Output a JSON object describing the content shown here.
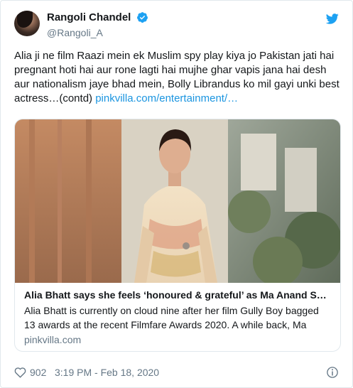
{
  "author": {
    "display_name": "Rangoli Chandel",
    "handle": "@Rangoli_A"
  },
  "tweet": {
    "text": "Alia ji ne film Raazi mein ek Muslim spy play kiya jo Pakistan jati hai pregnant hoti hai aur rone lagti hai mujhe ghar vapis jana hai desh aur nationalism jaye bhad mein, Bolly Librandus ko mil gayi unki best actress…(contd) ",
    "link_text": "pinkvilla.com/entertainment/…"
  },
  "card": {
    "title": "Alia Bhatt says she feels ‘honoured & grateful’ as Ma Anand S…",
    "description": "Alia Bhatt is currently on cloud nine after her film Gully Boy bagged 13 awards at the recent Filmfare Awards 2020. A while back, Ma",
    "domain": "pinkvilla.com"
  },
  "footer": {
    "likes": "902",
    "timestamp": "3:19 PM - Feb 18, 2020"
  },
  "icons": {
    "verified": "verified-badge-icon",
    "bird": "twitter-bird-icon",
    "heart": "heart-icon",
    "info": "info-icon"
  },
  "colors": {
    "accent": "#1da1f2",
    "link": "#1b95e0",
    "secondary_text": "#657786",
    "border": "#e1e8ed"
  }
}
